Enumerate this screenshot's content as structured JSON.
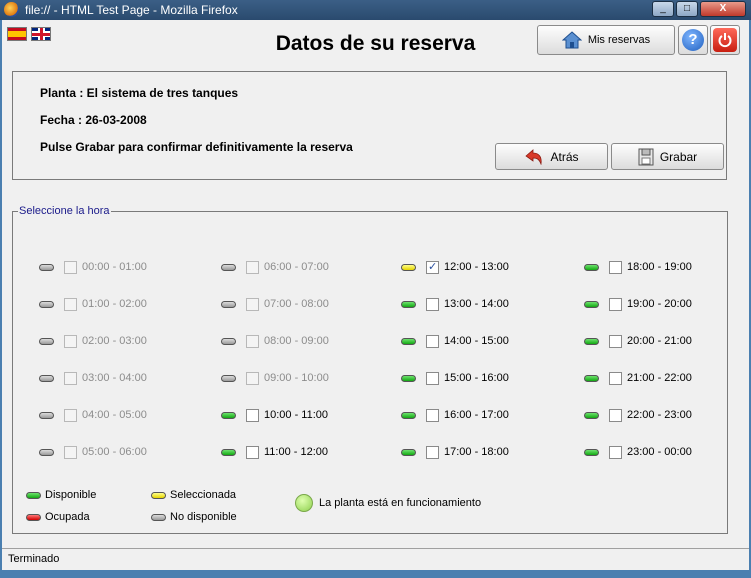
{
  "window": {
    "title": "file:// - HTML Test Page - Mozilla Firefox",
    "minimize": "_",
    "maximize": "□",
    "close": "X"
  },
  "header": {
    "title": "Datos de su reserva",
    "mis_reservas_label": "Mis reservas",
    "help_label": "?"
  },
  "info": {
    "planta": "Planta : El sistema de tres tanques",
    "fecha": "Fecha : 26-03-2008",
    "instruction": "Pulse Grabar para confirmar definitivamente la reserva",
    "back_label": "Atrás",
    "save_label": "Grabar"
  },
  "hours": {
    "legend": "Seleccione la hora",
    "slots": [
      {
        "label": "00:00 - 01:00",
        "status": "gray",
        "checked": false,
        "enabled": false
      },
      {
        "label": "01:00 - 02:00",
        "status": "gray",
        "checked": false,
        "enabled": false
      },
      {
        "label": "02:00 - 03:00",
        "status": "gray",
        "checked": false,
        "enabled": false
      },
      {
        "label": "03:00 - 04:00",
        "status": "gray",
        "checked": false,
        "enabled": false
      },
      {
        "label": "04:00 - 05:00",
        "status": "gray",
        "checked": false,
        "enabled": false
      },
      {
        "label": "05:00 - 06:00",
        "status": "gray",
        "checked": false,
        "enabled": false
      },
      {
        "label": "06:00 - 07:00",
        "status": "gray",
        "checked": false,
        "enabled": false
      },
      {
        "label": "07:00 - 08:00",
        "status": "gray",
        "checked": false,
        "enabled": false
      },
      {
        "label": "08:00 - 09:00",
        "status": "gray",
        "checked": false,
        "enabled": false
      },
      {
        "label": "09:00 - 10:00",
        "status": "gray",
        "checked": false,
        "enabled": false
      },
      {
        "label": "10:00 - 11:00",
        "status": "green",
        "checked": false,
        "enabled": true
      },
      {
        "label": "11:00 - 12:00",
        "status": "green",
        "checked": false,
        "enabled": true
      },
      {
        "label": "12:00 - 13:00",
        "status": "yellow",
        "checked": true,
        "enabled": true
      },
      {
        "label": "13:00 - 14:00",
        "status": "green",
        "checked": false,
        "enabled": true
      },
      {
        "label": "14:00 - 15:00",
        "status": "green",
        "checked": false,
        "enabled": true
      },
      {
        "label": "15:00 - 16:00",
        "status": "green",
        "checked": false,
        "enabled": true
      },
      {
        "label": "16:00 - 17:00",
        "status": "green",
        "checked": false,
        "enabled": true
      },
      {
        "label": "17:00 - 18:00",
        "status": "green",
        "checked": false,
        "enabled": true
      },
      {
        "label": "18:00 - 19:00",
        "status": "green",
        "checked": false,
        "enabled": true
      },
      {
        "label": "19:00 - 20:00",
        "status": "green",
        "checked": false,
        "enabled": true
      },
      {
        "label": "20:00 - 21:00",
        "status": "green",
        "checked": false,
        "enabled": true
      },
      {
        "label": "21:00 - 22:00",
        "status": "green",
        "checked": false,
        "enabled": true
      },
      {
        "label": "22:00 - 23:00",
        "status": "green",
        "checked": false,
        "enabled": true
      },
      {
        "label": "23:00 - 00:00",
        "status": "green",
        "checked": false,
        "enabled": true
      }
    ]
  },
  "legend": {
    "disponible": "Disponible",
    "seleccionada": "Seleccionada",
    "ocupada": "Ocupada",
    "no_disponible": "No disponible",
    "running": "La planta está en funcionamiento"
  },
  "status": {
    "text": "Terminado"
  },
  "colors": {
    "available": "#13a813",
    "selected": "#e6d400",
    "occupied": "#d10000",
    "unavailable": "#9a9a9a"
  }
}
